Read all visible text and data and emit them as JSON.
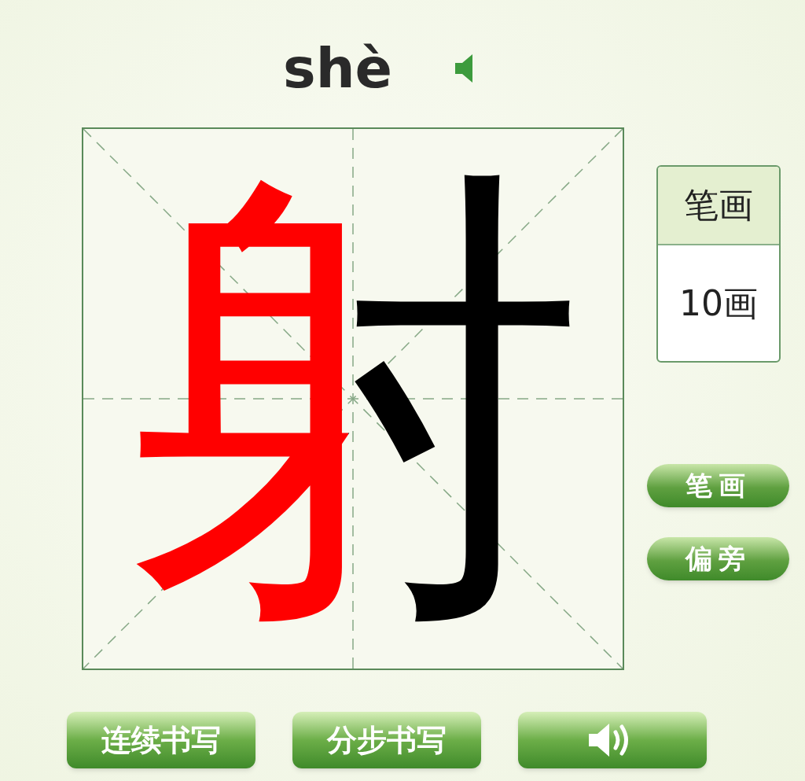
{
  "pinyin": "shè",
  "character": {
    "text": "射",
    "highlight_radical": true
  },
  "stroke_panel": {
    "header": "笔画",
    "count": "10画"
  },
  "side_buttons": [
    {
      "label": "笔画"
    },
    {
      "label": "偏旁"
    }
  ],
  "bottom_buttons": [
    {
      "kind": "text",
      "label": "连续书写"
    },
    {
      "kind": "text",
      "label": "分步书写"
    },
    {
      "kind": "sound"
    }
  ]
}
